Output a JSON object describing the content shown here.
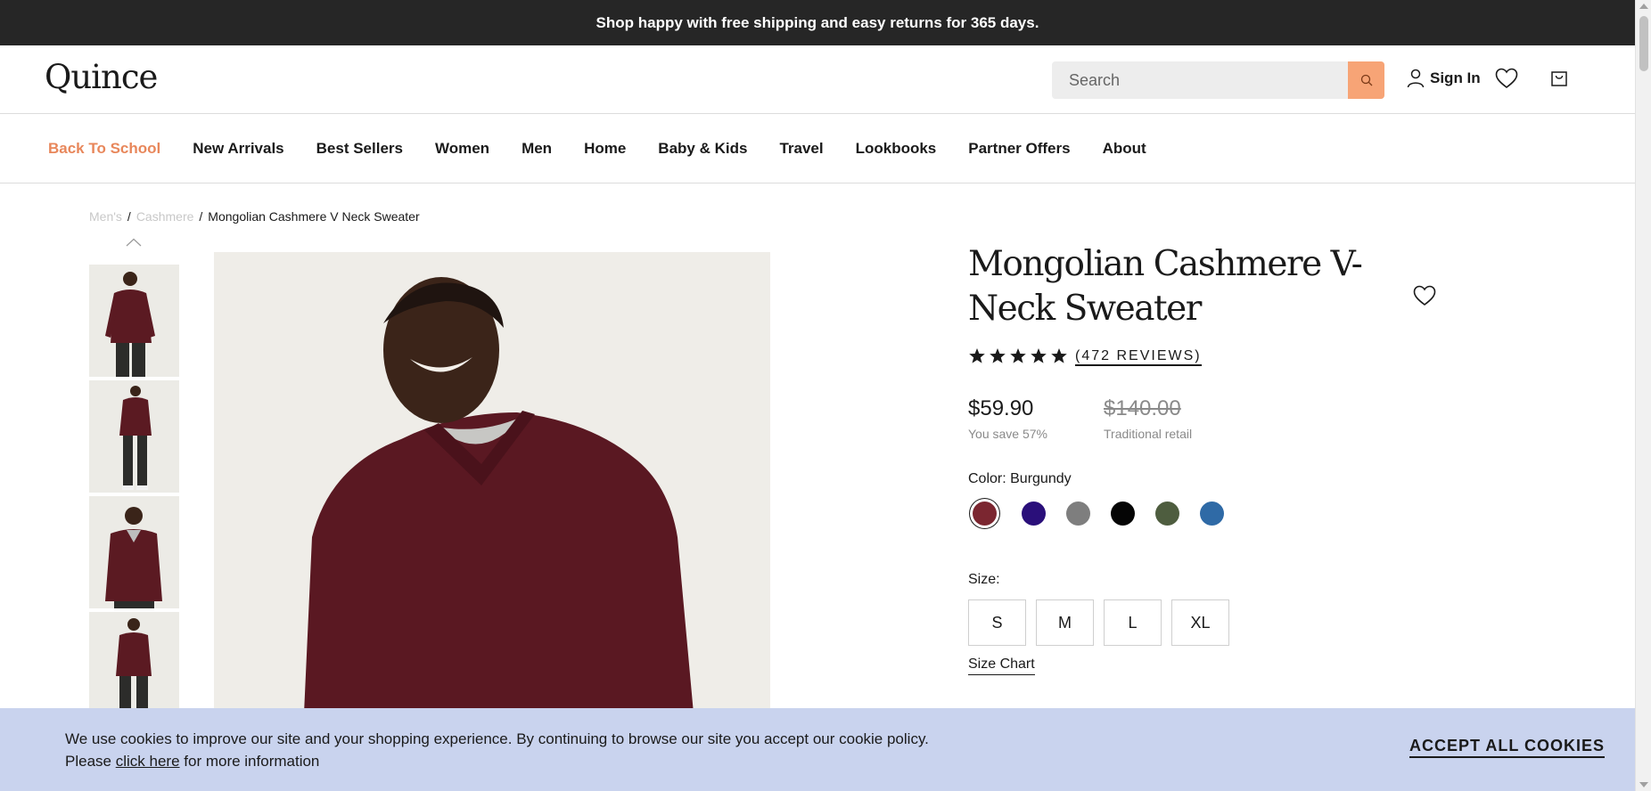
{
  "announcement": "Shop happy with free shipping and easy returns for 365 days.",
  "header": {
    "logo": "Quince",
    "search_placeholder": "Search",
    "signin_label": "Sign In"
  },
  "nav": {
    "items": [
      "Back To School",
      "New Arrivals",
      "Best Sellers",
      "Women",
      "Men",
      "Home",
      "Baby & Kids",
      "Travel",
      "Lookbooks",
      "Partner Offers",
      "About"
    ],
    "accent_color": "#e8875b"
  },
  "breadcrumb": {
    "items": [
      "Men's",
      "Cashmere",
      "Mongolian Cashmere V Neck Sweater"
    ],
    "separator": "/"
  },
  "product": {
    "title": "Mongolian Cashmere V-Neck Sweater",
    "rating": 5,
    "reviews_label": "(472 REVIEWS)",
    "price": "$59.90",
    "savings": "You save 57%",
    "original_price": "$140.00",
    "original_label": "Traditional retail",
    "color_label": "Color: Burgundy",
    "colors": [
      {
        "name": "Burgundy",
        "hex": "#7b2630",
        "selected": true
      },
      {
        "name": "Navy",
        "hex": "#2a0f7a",
        "selected": false
      },
      {
        "name": "Grey",
        "hex": "#7e7e7e",
        "selected": false
      },
      {
        "name": "Black",
        "hex": "#050505",
        "selected": false
      },
      {
        "name": "Olive",
        "hex": "#4e5d3f",
        "selected": false
      },
      {
        "name": "Blue",
        "hex": "#2f6aa6",
        "selected": false
      }
    ],
    "size_label": "Size:",
    "sizes": [
      "S",
      "M",
      "L",
      "XL"
    ],
    "size_chart_label": "Size Chart"
  },
  "cookie": {
    "line1": "We use cookies to improve our site and your shopping experience. By continuing to browse our site you accept our cookie policy.",
    "line2_prefix": "Please",
    "link": "click here",
    "line2_suffix": "for more information",
    "accept_label": "ACCEPT ALL COOKIES"
  }
}
